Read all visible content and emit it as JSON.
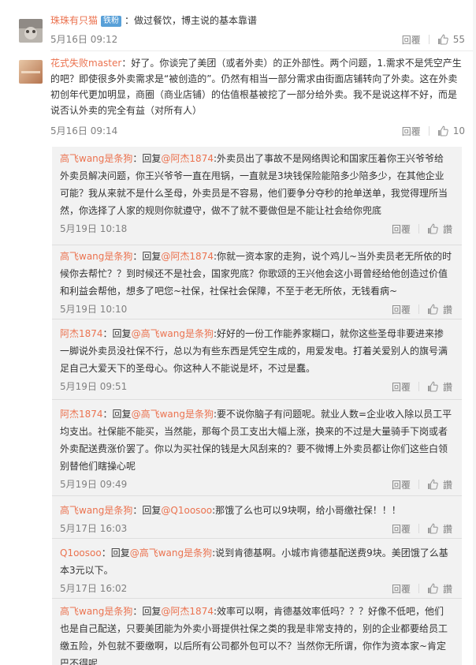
{
  "comments": [
    {
      "user": "珠珠有只猫",
      "badge": "铁粉",
      "text": "：做过餐饮，博主说的基本靠谱",
      "time": "5月16日 09:12",
      "reply_label": "回覆",
      "likes": "55"
    },
    {
      "user": "花式失败master",
      "text": "：好了。你谈完了美团（或者外卖）的正外部性。两个问题，1.需求不是凭空产生的吧？即使很多外卖需求是“被创造的”。仍然有相当一部分需求由街面店铺转向了外卖。这在外卖初创年代更加明显，商圈（商业店铺）的估值根基被挖了一部分给外卖。我不是说这样不好，而是说否认外卖的完全有益（对所有人）",
      "time": "5月16日 09:14",
      "reply_label": "回覆",
      "likes": "10"
    }
  ],
  "replies": [
    {
      "user": "高飞wang是条狗",
      "pre": "：回复",
      "target": "@阿杰1874",
      "text": ":外卖员出了事故不是网络舆论和国家压着你王兴爷爷给外卖员解决问题，你王兴爷爷一直在甩锅，一直就是3块钱保险能陪多少陪多少，在其他企业可能？我从来就不是什么圣母，外卖员是不容易，他们要争分夺秒的抢单送单，我觉得理所当然，你选择了人家的规则你就遵守，做不了就不要做但是不能让社会给你兜底",
      "time": "5月19日 10:18",
      "reply_label": "回覆",
      "like_label": "讚"
    },
    {
      "user": "高飞wang是条狗",
      "pre": "：回复",
      "target": "@阿杰1874",
      "text": ":你就一资本家的走狗，说个鸡儿~当外卖员老无所依的时候你去帮忙？？到时候还不是社会，国家兜底？你歌颂的王兴他会这小哥曾经给他创造过价值和利益会帮他，想多了吧您~社保，社保社会保障，不至于老无所依，无钱看病~",
      "time": "5月19日 10:10",
      "reply_label": "回覆",
      "like_label": "讚"
    },
    {
      "user": "阿杰1874",
      "pre": "：回复",
      "target": "@高飞wang是条狗",
      "text": ":好好的一份工作能养家糊口，就你这些圣母非要进来掺一脚说外卖员没社保不行，总以为有些东西是凭空生成的，用爱发电。打着关爱别人的旗号满足自己大爱天下的圣母心。你这种人不能说是坏，不过是蠢。",
      "time": "5月19日 09:51",
      "reply_label": "回覆",
      "like_label": "讚"
    },
    {
      "user": "阿杰1874",
      "pre": "：回复",
      "target": "@高飞wang是条狗",
      "text": ":要不说你脑子有问题呢。就业人数=企业收入除以员工平均支出。社保能不能买，当然能，那每个员工支出大幅上涨，换来的不过是大量骑手下岗或者外卖配送费涨价罢了。你以为买社保的钱是大风刮来的？要不微博上外卖员都让你们这些白领别替他们瞎操心呢",
      "time": "5月19日 09:49",
      "reply_label": "回覆",
      "like_label": "讚"
    },
    {
      "user": "高飞wang是条狗",
      "pre": "：回复",
      "target": "@Q1oosoo",
      "text": ":那饿了么也可以9块啊，给小哥缴社保！！！",
      "time": "5月17日 16:03",
      "reply_label": "回覆",
      "like_label": "讚"
    },
    {
      "user": "Q1oosoo",
      "pre": "：回复",
      "target": "@高飞wang是条狗",
      "text": ":说到肯德基啊。小城市肯德基配送费9块。美团饿了么基本3元以下。",
      "time": "5月17日 16:02",
      "reply_label": "回覆",
      "like_label": "讚"
    },
    {
      "user": "高飞wang是条狗",
      "pre": "：回复",
      "target": "@阿杰1874",
      "text": ":效率可以啊，肯德基效率低吗？？？好像不低吧，他们也是自己配送，只要美团能为外卖小哥提供社保之类的我是非常支持的，别的企业都要给员工缴五险，外包就不要缴啊，以后所有公司都外包可以不？当然你无所谓，你作为资本家~肯定巴不得呢",
      "time": "",
      "reply_label": "",
      "like_label": ""
    }
  ]
}
